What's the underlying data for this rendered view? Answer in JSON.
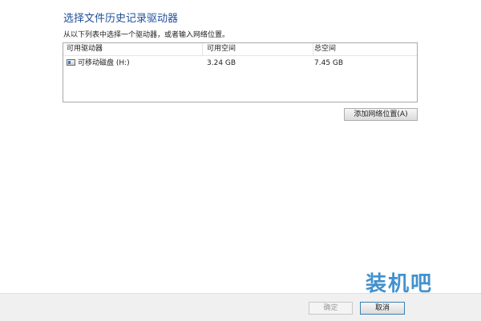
{
  "dialog": {
    "title": "选择文件历史记录驱动器",
    "instruction": "从以下列表中选择一个驱动器，或者输入网络位置。"
  },
  "drive_list": {
    "columns": [
      "可用驱动器",
      "可用空间",
      "总空间"
    ],
    "rows": [
      {
        "icon": "removable-drive-icon",
        "name": "可移动磁盘 (H:)",
        "free_space": "3.24 GB",
        "total_space": "7.45 GB"
      }
    ]
  },
  "buttons": {
    "add_network_location": "添加网络位置(A)",
    "ok": "确定",
    "cancel": "取消"
  },
  "watermark": {
    "text": "装机吧"
  }
}
